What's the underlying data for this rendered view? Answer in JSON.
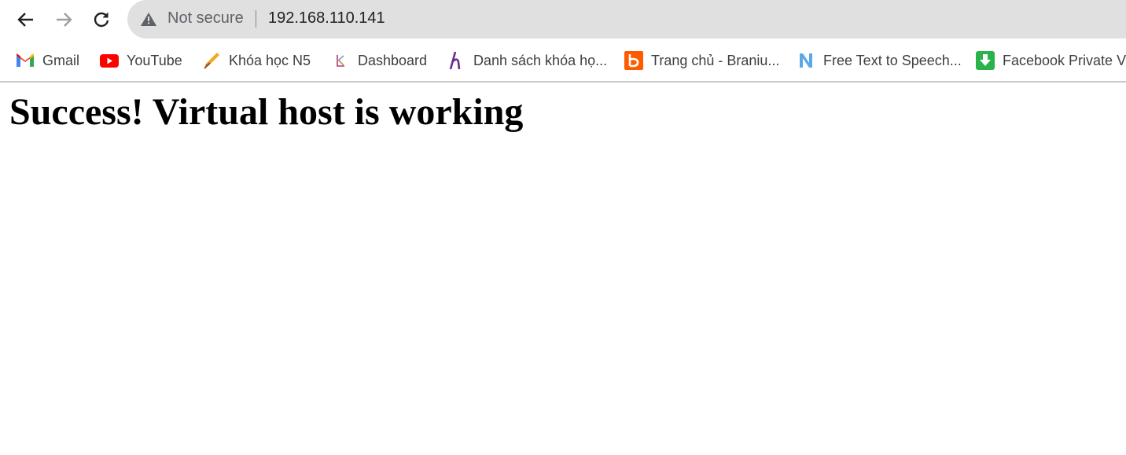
{
  "toolbar": {
    "back_icon": "arrow-left-icon",
    "forward_icon": "arrow-right-icon",
    "reload_icon": "reload-icon"
  },
  "omnibox": {
    "security_icon": "warning-triangle-icon",
    "security_label": "Not secure",
    "url": "192.168.110.141"
  },
  "bookmarks": [
    {
      "label": "Gmail",
      "icon": "gmail-icon"
    },
    {
      "label": "YouTube",
      "icon": "youtube-icon"
    },
    {
      "label": "Khóa học N5",
      "icon": "pencil-logo-icon"
    },
    {
      "label": "Dashboard",
      "icon": "dashboard-logo-icon"
    },
    {
      "label": "Danh sách khóa họ...",
      "icon": "h-logo-icon"
    },
    {
      "label": "Trang chủ - Braniu...",
      "icon": "b-logo-icon"
    },
    {
      "label": "Free Text to Speech...",
      "icon": "n-logo-icon"
    },
    {
      "label": "Facebook Private Vi",
      "icon": "download-icon"
    }
  ],
  "page": {
    "heading": "Success! Virtual host is working"
  }
}
